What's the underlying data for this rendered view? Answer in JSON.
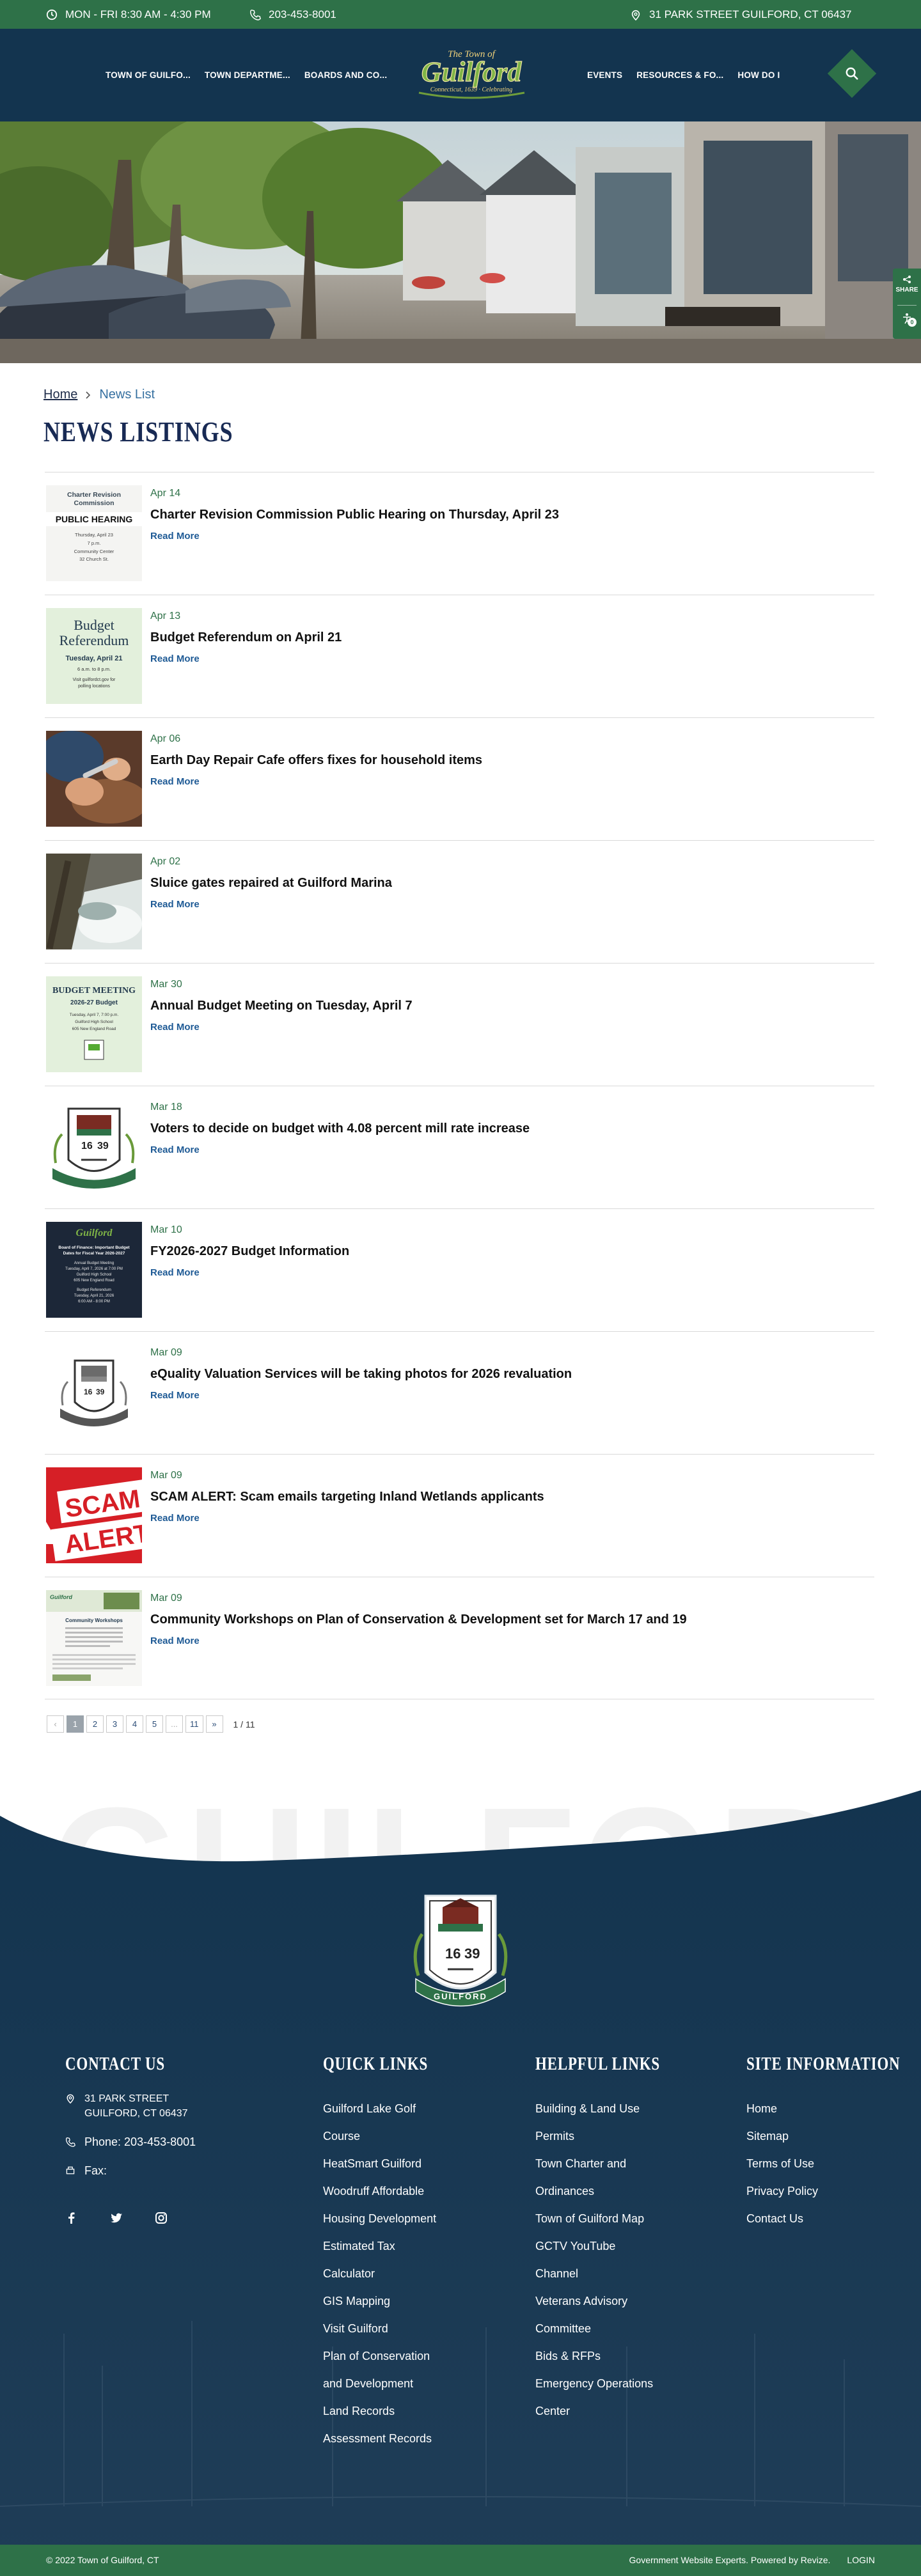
{
  "topbar": {
    "hours": "MON - FRI 8:30 AM - 4:30 PM",
    "phone": "203-453-8001",
    "address": "31 PARK STREET GUILFORD, CT 06437"
  },
  "nav": {
    "left": [
      "TOWN OF GUILFO...",
      "TOWN DEPARTME...",
      "BOARDS AND CO..."
    ],
    "right": [
      "EVENTS",
      "RESOURCES & FO...",
      "HOW DO I"
    ]
  },
  "logo": {
    "line1": "The Town of",
    "line2": "Guilford",
    "line3": "Connecticut, 1639 · Celebrating"
  },
  "share": {
    "label": "SHARE",
    "count": "0"
  },
  "breadcrumb": {
    "home": "Home",
    "current": "News List"
  },
  "page_title": "NEWS LISTINGS",
  "news": [
    {
      "date": "Apr 14",
      "title": "Charter Revision Commission Public Hearing on Thursday, April 23",
      "more": "Read More",
      "thumb": {
        "l1": "Charter Revision",
        "l2": "Commission",
        "l3": "PUBLIC HEARING",
        "l4": "Thursday, April 23",
        "l5": "7 p.m.",
        "l6": "Community Center",
        "l7": "32 Church St."
      }
    },
    {
      "date": "Apr 13",
      "title": "Budget Referendum on April 21",
      "more": "Read More",
      "thumb": {
        "l1": "Budget",
        "l2": "Referendum",
        "l3": "Tuesday, April 21",
        "l4": "6 a.m. to 8 p.m.",
        "l5": "Visit guilfordct.gov for",
        "l6": "polling locations"
      }
    },
    {
      "date": "Apr 06",
      "title": "Earth Day Repair Cafe offers fixes for household items",
      "more": "Read More"
    },
    {
      "date": "Apr 02",
      "title": "Sluice gates repaired at Guilford Marina",
      "more": "Read More"
    },
    {
      "date": "Mar 30",
      "title": "Annual Budget Meeting on Tuesday, April 7",
      "more": "Read More",
      "thumb": {
        "l1": "BUDGET MEETING",
        "l2": "2026-27 Budget",
        "l3": "Tuesday, April 7, 7:00 p.m.",
        "l4": "Guilford High School",
        "l5": "605 New England Road"
      }
    },
    {
      "date": "Mar 18",
      "title": "Voters to decide on budget with 4.08 percent mill rate increase",
      "more": "Read More"
    },
    {
      "date": "Mar 10",
      "title": "FY2026-2027 Budget Information",
      "more": "Read More",
      "thumb": {
        "l1": "Guilford",
        "l2": "Board of Finance: Important Budget",
        "l3": "Dates for Fiscal Year 2026-2027",
        "l4": "Annual Budget Meeting",
        "l5": "Tuesday, April 7, 2026 at 7:00 PM",
        "l6": "Guilford High School",
        "l7": "605 New England Road",
        "l8": "Budget Referendum",
        "l9": "Tuesday, April 21, 2026",
        "l10": "6:00 AM - 8:00 PM"
      }
    },
    {
      "date": "Mar 09",
      "title": "eQuality Valuation Services will be taking photos for 2026 revaluation",
      "more": "Read More"
    },
    {
      "date": "Mar 09",
      "title": "SCAM ALERT: Scam emails targeting Inland Wetlands applicants",
      "more": "Read More",
      "thumb": {
        "l1": "SCAM",
        "l2": "ALERT"
      }
    },
    {
      "date": "Mar 09",
      "title": "Community Workshops on Plan of Conservation & Development set for March 17 and 19",
      "more": "Read More",
      "thumb": {
        "l1": "Guilford",
        "l2": "Community Workshops"
      }
    }
  ],
  "pagination": {
    "prev": "‹",
    "pages": [
      "1",
      "2",
      "3",
      "4",
      "5",
      "...",
      "11"
    ],
    "next": "»",
    "info": "1 / 11",
    "current_page": 1
  },
  "footer": {
    "watermark": "GUILFORD",
    "seal": {
      "top": "1639",
      "banner": "GUILFORD",
      "year_left": "16",
      "year_right": "39"
    },
    "contact": {
      "heading": "CONTACT US",
      "address1": "31 PARK STREET",
      "address2": "GUILFORD, CT 06437",
      "phone": "Phone: 203-453-8001",
      "fax": "Fax:"
    },
    "quick_links": {
      "heading": "QUICK LINKS",
      "items": [
        "Guilford Lake Golf",
        "Course",
        "HeatSmart Guilford",
        "Woodruff Affordable",
        "Housing Development",
        "Estimated Tax",
        "Calculator",
        "GIS Mapping",
        "Visit Guilford",
        "Plan of Conservation",
        "and Development",
        "Land Records",
        "Assessment Records"
      ]
    },
    "helpful_links": {
      "heading": "HELPFUL LINKS",
      "items": [
        "Building & Land Use",
        "Permits",
        "Town Charter and",
        "Ordinances",
        "Town of Guilford Map",
        "GCTV YouTube",
        "Channel",
        "Veterans Advisory",
        "Committee",
        "Bids & RFPs",
        "Emergency Operations",
        "Center"
      ]
    },
    "site_info": {
      "heading": "SITE INFORMATION",
      "items": [
        "Home",
        "Sitemap",
        "Terms of Use",
        "Privacy Policy",
        "Contact Us"
      ]
    }
  },
  "bottombar": {
    "copyright": "© 2022 Town of Guilford, CT",
    "credit": "Government Website Experts. Powered by Revize.",
    "login": "LOGIN"
  },
  "colors": {
    "green": "#2e7148",
    "navy": "#13344f",
    "title": "#182a54",
    "link": "#1e5a95"
  }
}
